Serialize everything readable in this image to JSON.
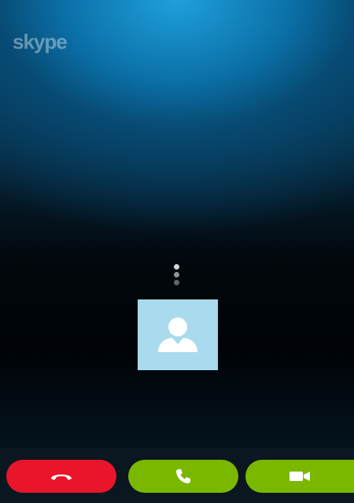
{
  "brand": {
    "logo_text": "skype"
  },
  "call": {
    "status": "connecting",
    "caller_icon": "default-avatar-icon"
  },
  "controls": {
    "end_call": {
      "icon": "hang-up-icon",
      "color": "#e8152b"
    },
    "audio_call": {
      "icon": "phone-icon",
      "color": "#7ab800"
    },
    "video_call": {
      "icon": "video-camera-icon",
      "color": "#7ab800"
    }
  },
  "colors": {
    "accent_blue": "#1fa0dc",
    "avatar_bg": "#a9daee",
    "end_red": "#e8152b",
    "answer_green": "#7ab800"
  }
}
